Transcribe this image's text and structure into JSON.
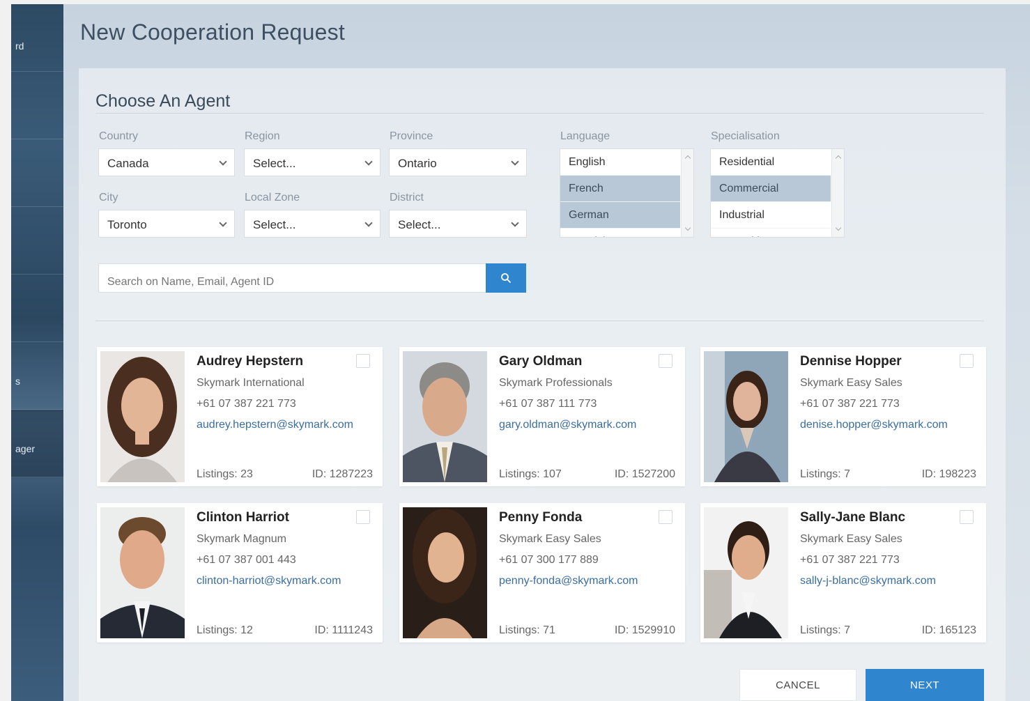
{
  "sidebar": {
    "items": [
      {
        "label": "rd"
      },
      {
        "label": ""
      },
      {
        "label": ""
      },
      {
        "label": ""
      },
      {
        "label": ""
      },
      {
        "label": "s"
      },
      {
        "label": "ager"
      },
      {
        "label": ""
      }
    ]
  },
  "header": {
    "title": "New Cooperation Request"
  },
  "panel": {
    "title": "Choose An Agent"
  },
  "filters": {
    "country": {
      "label": "Country",
      "value": "Canada"
    },
    "region": {
      "label": "Region",
      "value": "Select..."
    },
    "province": {
      "label": "Province",
      "value": "Ontario"
    },
    "city": {
      "label": "City",
      "value": "Toronto"
    },
    "local_zone": {
      "label": "Local Zone",
      "value": "Select..."
    },
    "district": {
      "label": "District",
      "value": "Select..."
    },
    "language": {
      "label": "Language",
      "options": [
        {
          "label": "English",
          "selected": false
        },
        {
          "label": "French",
          "selected": true
        },
        {
          "label": "German",
          "selected": true
        },
        {
          "label": "Spanish",
          "selected": false
        }
      ]
    },
    "specialisation": {
      "label": "Specialisation",
      "options": [
        {
          "label": "Residential",
          "selected": false
        },
        {
          "label": "Commercial",
          "selected": true
        },
        {
          "label": "Industrial",
          "selected": false
        },
        {
          "label": "Consulting",
          "selected": false
        }
      ]
    }
  },
  "search": {
    "placeholder": "Search on Name, Email, Agent ID"
  },
  "agents": [
    {
      "name": "Audrey Hepstern",
      "company": "Skymark International",
      "phone": "+61 07 387 221 773",
      "email": "audrey.hepstern@skymark.com",
      "listings": "Listings: 23",
      "id": "ID: 1287223"
    },
    {
      "name": "Gary Oldman",
      "company": "Skymark Professionals",
      "phone": "+61 07 387 111 773",
      "email": "gary.oldman@skymark.com",
      "listings": "Listings: 107",
      "id": "ID: 1527200"
    },
    {
      "name": "Dennise Hopper",
      "company": "Skymark Easy Sales",
      "phone": "+61 07 387 221 773",
      "email": "denise.hopper@skymark.com",
      "listings": "Listings: 7",
      "id": "ID: 198223"
    },
    {
      "name": "Clinton Harriot",
      "company": "Skymark Magnum",
      "phone": "+61 07 387 001 443",
      "email": "clinton-harriot@skymark.com",
      "listings": "Listings: 12",
      "id": "ID: 1111243"
    },
    {
      "name": "Penny Fonda",
      "company": "Skymark Easy Sales",
      "phone": "+61 07 300 177 889",
      "email": "penny-fonda@skymark.com",
      "listings": "Listings: 71",
      "id": "ID: 1529910"
    },
    {
      "name": "Sally-Jane Blanc",
      "company": "Skymark Easy Sales",
      "phone": "+61 07 387 221 773",
      "email": "sally-j-blanc@skymark.com",
      "listings": "Listings: 7",
      "id": "ID: 165123"
    }
  ],
  "actions": {
    "cancel": "CANCEL",
    "next": "NEXT"
  },
  "colors": {
    "accent": "#2f86cf",
    "selected_option": "#b9c8d6",
    "link": "#3a6ea0"
  }
}
